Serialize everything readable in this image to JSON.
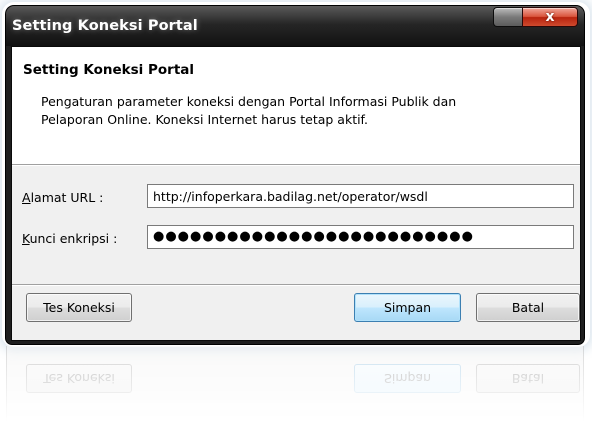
{
  "window": {
    "title": "Setting Koneksi Portal",
    "close_glyph": "x"
  },
  "header": {
    "title": "Setting Koneksi Portal",
    "description": "Pengaturan parameter koneksi dengan Portal Informasi Publik dan Pelaporan Online. Koneksi Internet harus tetap aktif."
  },
  "form": {
    "url_label_accel": "A",
    "url_label_rest": "lamat URL :",
    "url_value": "http://infoperkara.badilag.net/operator/wsdl",
    "key_label_accel": "K",
    "key_label_rest": "unci enkripsi :",
    "key_value": "●●●●●●●●●●●●●●●●●●●●●●●●●●"
  },
  "buttons": {
    "test": "Tes Koneksi",
    "save": "Simpan",
    "cancel": "Batal"
  },
  "colors": {
    "titlebar": "#1e1e1e",
    "close_button": "#c8381c",
    "default_button_border": "#3c7fb1",
    "client_bg": "#f0f0f0"
  }
}
